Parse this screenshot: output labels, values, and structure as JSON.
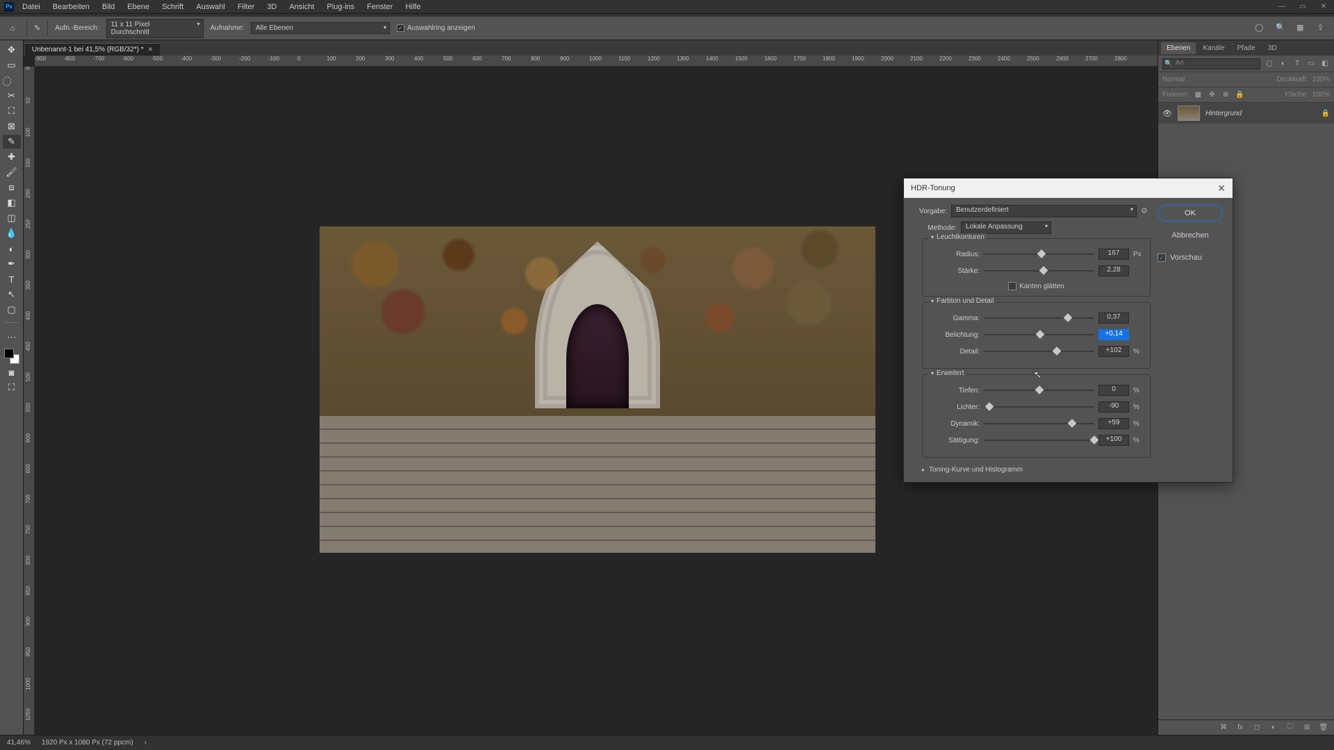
{
  "menu": {
    "items": [
      "Datei",
      "Bearbeiten",
      "Bild",
      "Ebene",
      "Schrift",
      "Auswahl",
      "Filter",
      "3D",
      "Ansicht",
      "Plug-ins",
      "Fenster",
      "Hilfe"
    ]
  },
  "options": {
    "sample_label": "Aufn.-Bereich:",
    "sample_value": "11 x 11 Pixel Durchschnitt",
    "layers_label": "Aufnahme:",
    "layers_value": "Alle Ebenen",
    "show_sel": "Auswahlring anzeigen"
  },
  "doc_tab": "Unbenannt-1 bei 41,5% (RGB/32*) *",
  "ruler_h": [
    "-900",
    "-800",
    "-700",
    "-600",
    "-500",
    "-400",
    "-300",
    "-200",
    "-100",
    "0",
    "100",
    "200",
    "300",
    "400",
    "500",
    "600",
    "700",
    "800",
    "900",
    "1000",
    "1100",
    "1200",
    "1300",
    "1400",
    "1500",
    "1600",
    "1700",
    "1800",
    "1900",
    "2000",
    "2100",
    "2200",
    "2300",
    "2400",
    "2500",
    "2600",
    "2700",
    "2800"
  ],
  "ruler_v": [
    "0",
    "50",
    "100",
    "150",
    "200",
    "250",
    "300",
    "350",
    "400",
    "450",
    "500",
    "550",
    "600",
    "650",
    "700",
    "750",
    "800",
    "850",
    "900",
    "950",
    "1000",
    "1050"
  ],
  "panels": {
    "tabs": [
      "Ebenen",
      "Kanäle",
      "Pfade",
      "3D"
    ],
    "search_ph": "Art",
    "blend": "Normal",
    "opacity_l": "Deckkraft:",
    "opacity_v": "100%",
    "lock_l": "Fixieren:",
    "fill_l": "Fläche:",
    "fill_v": "100%",
    "layer_name": "Hintergrund"
  },
  "dialog": {
    "title": "HDR-Tonung",
    "preset_l": "Vorgabe:",
    "preset_v": "Benutzerdefiniert",
    "method_l": "Methode:",
    "method_v": "Lokale Anpassung",
    "ok": "OK",
    "cancel": "Abbrechen",
    "preview": "Vorschau",
    "sec1": "Leuchtkonturen",
    "radius_l": "Radius:",
    "radius_v": "167",
    "radius_u": "Px",
    "strength_l": "Stärke:",
    "strength_v": "2,28",
    "edge_smooth": "Kanten glätten",
    "sec2": "Farbton und Detail",
    "gamma_l": "Gamma:",
    "gamma_v": "0,37",
    "exposure_l": "Belichtung:",
    "exposure_v": "+0,14",
    "detail_l": "Detail:",
    "detail_v": "+102",
    "pct": "%",
    "sec3": "Erweitert",
    "shadow_l": "Tiefen:",
    "shadow_v": "0",
    "highlight_l": "Lichter:",
    "highlight_v": "-90",
    "vibrance_l": "Dynamik:",
    "vibrance_v": "+59",
    "saturation_l": "Sättigung:",
    "saturation_v": "+100",
    "sec4": "Toning-Kurve und Histogramm"
  },
  "status": {
    "zoom": "41,46%",
    "info": "1920 Px x 1080 Px (72 ppcm)"
  }
}
